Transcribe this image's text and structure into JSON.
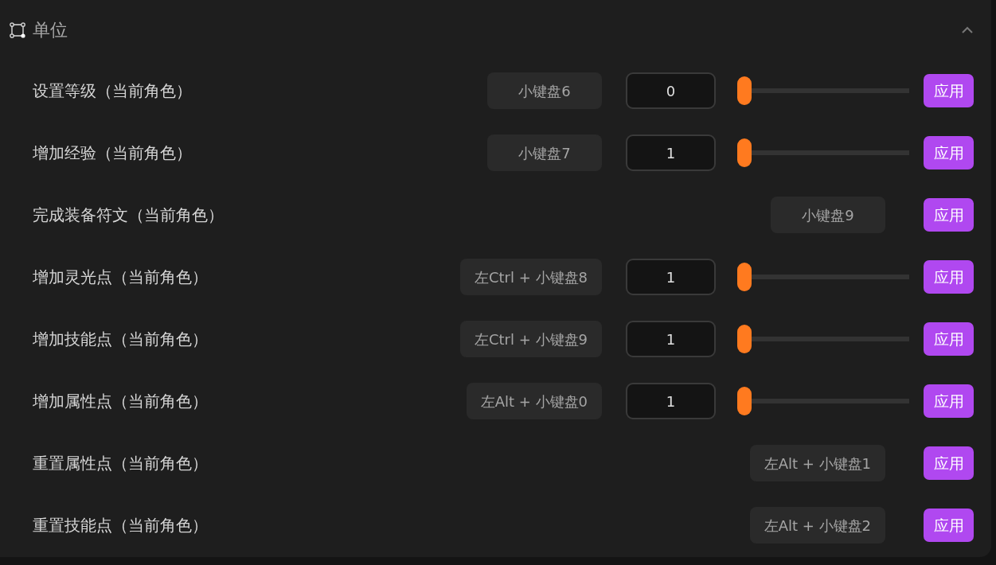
{
  "section": {
    "title": "单位",
    "expanded": true
  },
  "rows": [
    {
      "kind": "slider",
      "label": "设置等级（当前角色）",
      "hotkey": "小键盘6",
      "value": "0",
      "level": 0,
      "button": "应用"
    },
    {
      "kind": "slider",
      "label": "增加经验（当前角色）",
      "hotkey": "小键盘7",
      "value": "1",
      "level": 0,
      "button": "应用"
    },
    {
      "kind": "action",
      "label": "完成装备符文（当前角色）",
      "hotkey": "小键盘9",
      "button": "应用"
    },
    {
      "kind": "slider",
      "label": "增加灵光点（当前角色）",
      "hotkey": "左Ctrl + 小键盘8",
      "value": "1",
      "level": 0,
      "button": "应用"
    },
    {
      "kind": "slider",
      "label": "增加技能点（当前角色）",
      "hotkey": "左Ctrl + 小键盘9",
      "value": "1",
      "level": 0,
      "button": "应用"
    },
    {
      "kind": "slider",
      "label": "增加属性点（当前角色）",
      "hotkey": "左Alt + 小键盘0",
      "value": "1",
      "level": 0,
      "button": "应用"
    },
    {
      "kind": "action",
      "label": "重置属性点（当前角色）",
      "hotkey": "左Alt + 小键盘1",
      "button": "应用"
    },
    {
      "kind": "action",
      "label": "重置技能点（当前角色）",
      "hotkey": "左Alt + 小键盘2",
      "button": "应用"
    }
  ]
}
